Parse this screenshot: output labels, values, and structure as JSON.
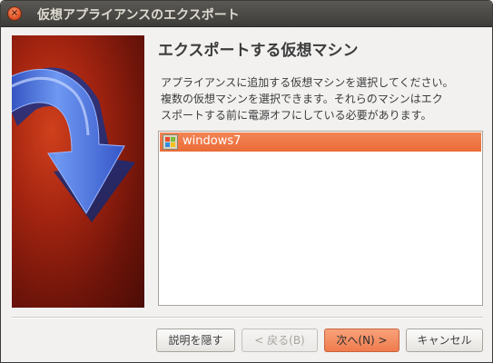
{
  "window": {
    "title": "仮想アプライアンスのエクスポート",
    "close_glyph": "×"
  },
  "page": {
    "heading": "エクスポートする仮想マシン",
    "description_lines": [
      "アプライアンスに追加する仮想マシンを選択してください。",
      "複数の仮想マシンを選択できます。それらのマシンはエク",
      "スポートする前に電源オフにしている必要があります。"
    ]
  },
  "vm_list": {
    "items": [
      {
        "label": "windows7",
        "icon": "windows-vm-icon",
        "selected": true
      }
    ],
    "selection_color": "#f07746"
  },
  "buttons": {
    "hide_description": "説明を隠す",
    "back": "< 戻る(B)",
    "next": "次へ(N) >",
    "cancel": "キャンセル"
  },
  "colors": {
    "accent": "#f07746",
    "titlebar": "#3d3c38",
    "sidebar_background": "#a32410",
    "arrow": "#4a74e0"
  }
}
